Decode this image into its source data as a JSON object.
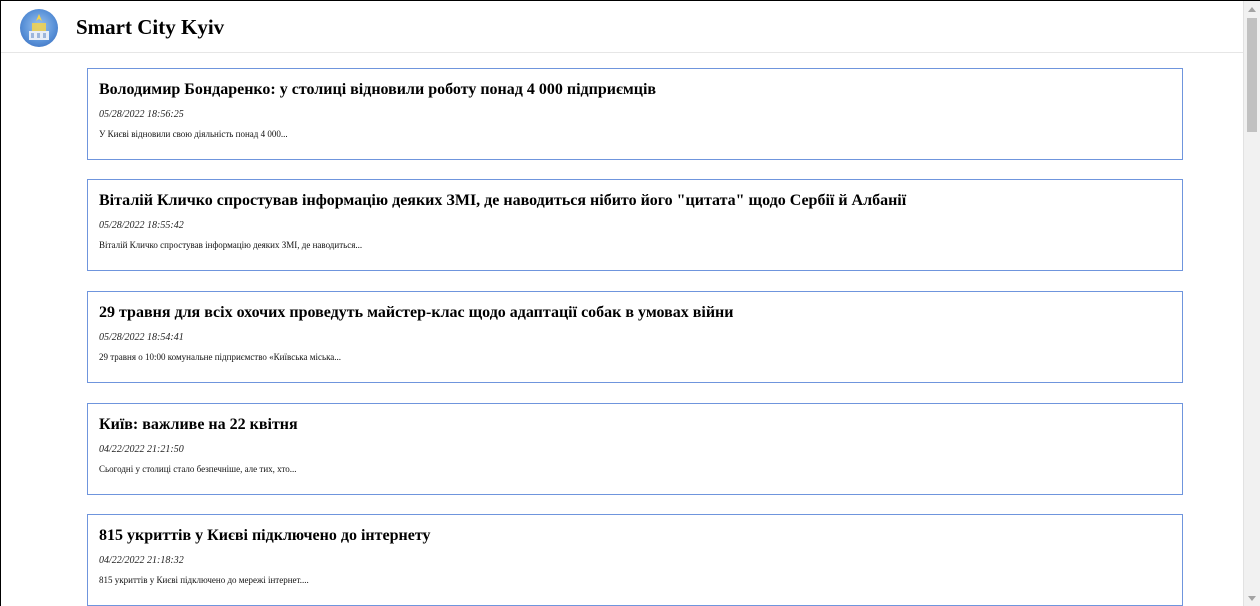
{
  "app": {
    "title": "Smart City Kyiv",
    "logo_icon": "kyiv-coat-of-arms-icon"
  },
  "news": [
    {
      "title": "Володимир Бондаренко: у столиці відновили роботу понад 4 000 підприємців",
      "date": "05/28/2022 18:56:25",
      "excerpt": "У Києві відновили свою діяльність понад 4 000..."
    },
    {
      "title": "Віталій Кличко спростував інформацію деяких ЗМІ, де наводиться нібито його \"цитата\" щодо Сербії й Албанії",
      "date": "05/28/2022 18:55:42",
      "excerpt": "Віталій Кличко спростував інформацію деяких ЗМІ, де наводиться..."
    },
    {
      "title": "29 травня для всіх охочих проведуть майстер-клас щодо адаптації собак в умовах війни",
      "date": "05/28/2022 18:54:41",
      "excerpt": "29 травня о 10:00 комунальне підприємство «Київська міська..."
    },
    {
      "title": "Київ: важливе на 22 квітня",
      "date": "04/22/2022 21:21:50",
      "excerpt": "Сьогодні у столиці стало безпечніше, але тих, хто..."
    },
    {
      "title": "815 укриттів у Києві підключено до інтернету",
      "date": "04/22/2022 21:18:32",
      "excerpt": "815 укриттів у Києві підключено до мережі інтернет...."
    }
  ],
  "colors": {
    "card_border": "#6f95dd",
    "header_divider": "#e6e6e6"
  }
}
